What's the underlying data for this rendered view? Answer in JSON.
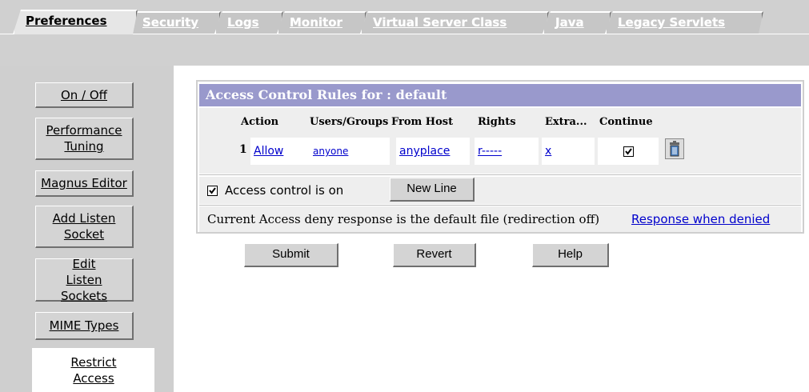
{
  "tabs": [
    {
      "label": "Preferences",
      "active": true
    },
    {
      "label": "Security",
      "active": false
    },
    {
      "label": "Logs",
      "active": false
    },
    {
      "label": "Monitor",
      "active": false
    },
    {
      "label": "Virtual Server Class",
      "active": false
    },
    {
      "label": "Java",
      "active": false
    },
    {
      "label": "Legacy Servlets",
      "active": false
    }
  ],
  "sidebar": {
    "items": [
      {
        "label": "On / Off"
      },
      {
        "label": "Performance Tuning"
      },
      {
        "label": "Magnus Editor"
      },
      {
        "label": "Add Listen Socket"
      },
      {
        "label": "Edit Listen Sockets"
      },
      {
        "label": "MIME Types"
      },
      {
        "label": "Restrict Access",
        "selected": true
      }
    ]
  },
  "acl": {
    "title": "Access Control Rules for : default",
    "columns": [
      "Action",
      "Users/Groups",
      "From Host",
      "Rights",
      "Extra...",
      "Continue"
    ],
    "rows": [
      {
        "num": "1",
        "action": "Allow",
        "users": "anyone",
        "host": "anyplace",
        "rights": "r-----",
        "extra": "x",
        "continue": true,
        "delete_icon": "trash-icon"
      }
    ],
    "access_control_label": "Access control is on",
    "access_control_checked": true,
    "new_line_label": "New Line",
    "deny_text": "Current Access deny response is the default file (redirection off)",
    "deny_link": "Response when denied"
  },
  "actions": {
    "submit": "Submit",
    "revert": "Revert",
    "help": "Help"
  },
  "colors": {
    "title_bar": "#9999cc",
    "link": "#0000cc",
    "chrome": "#d0d0d0"
  }
}
